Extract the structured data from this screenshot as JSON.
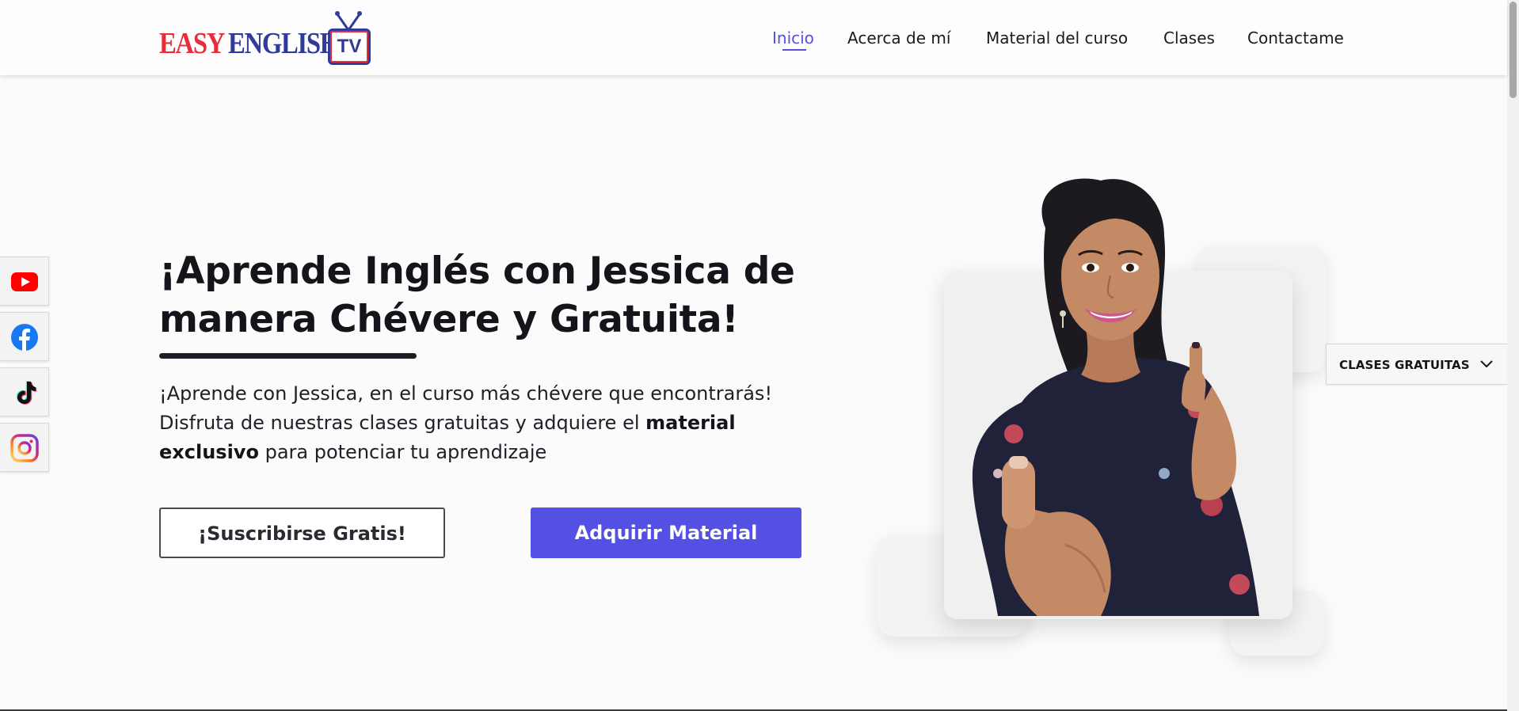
{
  "brand": {
    "logo_easy": "EASY",
    "logo_english": "ENGLISH",
    "logo_tv": "TV",
    "colors": {
      "red": "#e52d3c",
      "navy": "#2f3a9a"
    }
  },
  "nav": {
    "items": [
      {
        "label": "Inicio",
        "active": true
      },
      {
        "label": "Acerca de mí"
      },
      {
        "label": "Material del curso"
      },
      {
        "label": "Clases"
      },
      {
        "label": "Contactame"
      }
    ],
    "accent": "#5450e4"
  },
  "social": {
    "items": [
      {
        "icon": "youtube-icon"
      },
      {
        "icon": "facebook-icon"
      },
      {
        "icon": "tiktok-icon"
      },
      {
        "icon": "instagram-icon"
      }
    ]
  },
  "hero": {
    "title": "¡Aprende Inglés con Jessica de manera Chévere y Gratuita!",
    "subtitle_part1": "¡Aprende con Jessica, en el curso más chévere que encontrarás! Disfruta de nuestras clases gratuitas y adquiere el ",
    "subtitle_bold": "material exclusivo",
    "subtitle_part2": " para potenciar tu aprendizaje",
    "button_subscribe": "¡Suscribirse Gratis!",
    "button_buy": "Adquirir Material",
    "button_primary_color": "#5450e4"
  },
  "dropdown": {
    "label": "CLASES GRATUITAS",
    "icon": "chevron-down-icon"
  }
}
